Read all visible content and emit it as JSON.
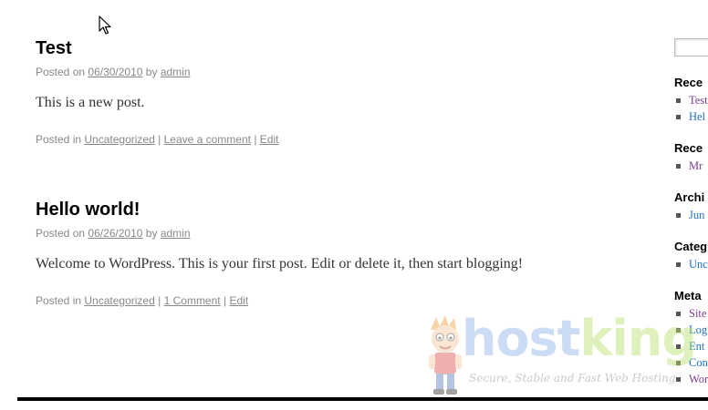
{
  "posts": [
    {
      "title": "Test",
      "posted_on_label": "Posted on",
      "date": "06/30/2010",
      "by_label": "by",
      "author": "admin",
      "body": "This is a new post.",
      "posted_in_label": "Posted in",
      "category": "Uncategorized",
      "comments_link": "Leave a comment",
      "edit_link": "Edit"
    },
    {
      "title": "Hello world!",
      "posted_on_label": "Posted on",
      "date": "06/26/2010",
      "by_label": "by",
      "author": "admin",
      "body": "Welcome to WordPress. This is your first post. Edit or delete it, then start blogging!",
      "posted_in_label": "Posted in",
      "category": "Uncategorized",
      "comments_link": "1 Comment",
      "edit_link": "Edit"
    }
  ],
  "sidebar": {
    "search": {
      "value": ""
    },
    "widgets": [
      {
        "title": "Rece",
        "items": [
          "Test",
          "Hel"
        ]
      },
      {
        "title": "Rece",
        "items": [
          "Mr"
        ]
      },
      {
        "title": "Archi",
        "items": [
          "Jun"
        ]
      },
      {
        "title": "Categ",
        "items": [
          "Unc"
        ]
      },
      {
        "title": "Meta",
        "items": [
          "Site",
          "Log",
          "Ent",
          "Con",
          "Wor"
        ]
      }
    ]
  },
  "separator": "|",
  "watermark": {
    "brand_part1": "host",
    "brand_part2": "king",
    "tagline": "Secure, Stable and Fast Web Hosting"
  }
}
